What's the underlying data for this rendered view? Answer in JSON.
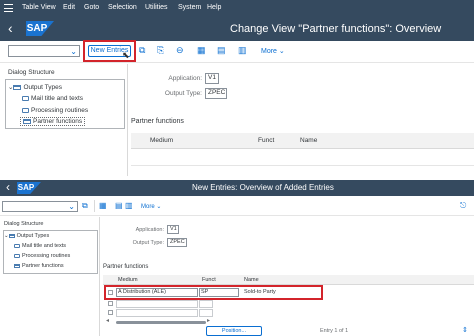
{
  "top": {
    "menu": [
      "Table View",
      "Edit",
      "Goto",
      "Selection",
      "Utilities",
      "System",
      "Help"
    ],
    "logo": "SAP",
    "title": "Change View \"Partner functions\": Overview",
    "toolbar": {
      "new_entries": "New Entries",
      "more": "More"
    },
    "dialog_structure": {
      "heading": "Dialog Structure",
      "items": [
        "Output Types",
        "Mail title and texts",
        "Processing routines",
        "Partner functions"
      ]
    },
    "fields": {
      "application_label": "Application:",
      "application_value": "V1",
      "output_type_label": "Output Type:",
      "output_type_value": "ZPEC"
    },
    "partner": {
      "title": "Partner functions",
      "columns": [
        "Medium",
        "Funct",
        "Name"
      ]
    }
  },
  "bottom": {
    "logo": "SAP",
    "title": "New Entries: Overview of Added Entries",
    "toolbar": {
      "more": "More"
    },
    "dialog_structure": {
      "heading": "Dialog Structure",
      "items": [
        "Output Types",
        "Mail title and texts",
        "Processing routines",
        "Partner functions"
      ]
    },
    "fields": {
      "application_label": "Application:",
      "application_value": "V1",
      "output_type_label": "Output Type:",
      "output_type_value": "ZPEC"
    },
    "partner": {
      "title": "Partner functions",
      "columns": [
        "Medium",
        "Funct",
        "Name"
      ],
      "row": {
        "medium": "A Distribution (ALE)",
        "funct": "SP",
        "name": "Sold-to Party"
      }
    },
    "position_button": "Position...",
    "entry_text": "Entry 1 of 1"
  },
  "colors": {
    "shell": "#354a5f",
    "accent": "#0a6ed1",
    "highlight": "#d3242b",
    "sap_blue": "#1a73d0"
  }
}
